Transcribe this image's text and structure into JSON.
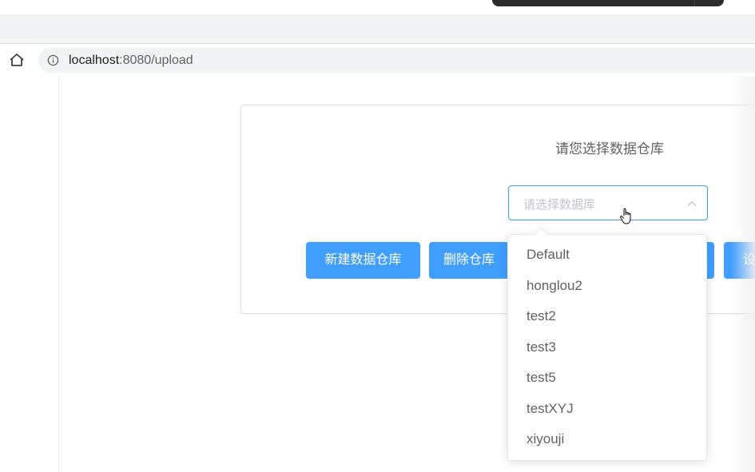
{
  "browser": {
    "url_host": "localhost",
    "url_port_path": ":8080/upload"
  },
  "card": {
    "title": "请您选择数据仓库",
    "select_placeholder": "请选择数据库"
  },
  "buttons": {
    "new_warehouse": "新建数据仓库",
    "delete_warehouse": "删除仓库",
    "settings_partial": "设"
  },
  "dropdown": {
    "options": [
      "Default",
      "honglou2",
      "test2",
      "test3",
      "test5",
      "testXYJ",
      "xiyouji"
    ]
  },
  "colors": {
    "primary": "#409eff",
    "placeholder": "#c0c4cc",
    "text": "#606266"
  },
  "icons": [
    "home-icon",
    "info-icon",
    "chevron-up-icon",
    "hand-cursor-icon"
  ]
}
